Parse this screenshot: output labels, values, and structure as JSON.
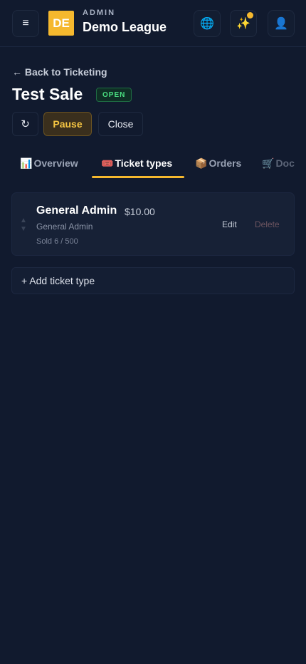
{
  "header": {
    "menu_icon": "≡",
    "logo_text": "DE",
    "org_kicker": "ADMIN",
    "org_name": "Demo League",
    "globe_icon": "🌐",
    "sparkle_icon": "✨",
    "user_icon": "👤"
  },
  "nav": {
    "back_label": "← Back to Ticketing"
  },
  "event": {
    "title": "Test Sale",
    "status": "OPEN"
  },
  "actions": {
    "refresh_icon": "↻",
    "pause_label": "Pause",
    "close_label": "Close"
  },
  "tabs": [
    {
      "icon": "📊",
      "label": "Overview"
    },
    {
      "icon": "🎟️",
      "label": "Ticket types"
    },
    {
      "icon": "📦",
      "label": "Orders"
    },
    {
      "icon": "🛒",
      "label": "Doc"
    }
  ],
  "active_tab": "Ticket types",
  "ticket_types": [
    {
      "name": "General Admin",
      "price": "$10.00",
      "description": "General Admin",
      "sold": "Sold 6 / 500",
      "edit_label": "Edit",
      "delete_label": "Delete",
      "up_icon": "▲",
      "down_icon": "▼"
    }
  ],
  "add_ticket_label": "+ Add ticket type",
  "colors": {
    "background": "#111a2e",
    "accent": "#f5b82e",
    "status_open": "#4ade80"
  }
}
